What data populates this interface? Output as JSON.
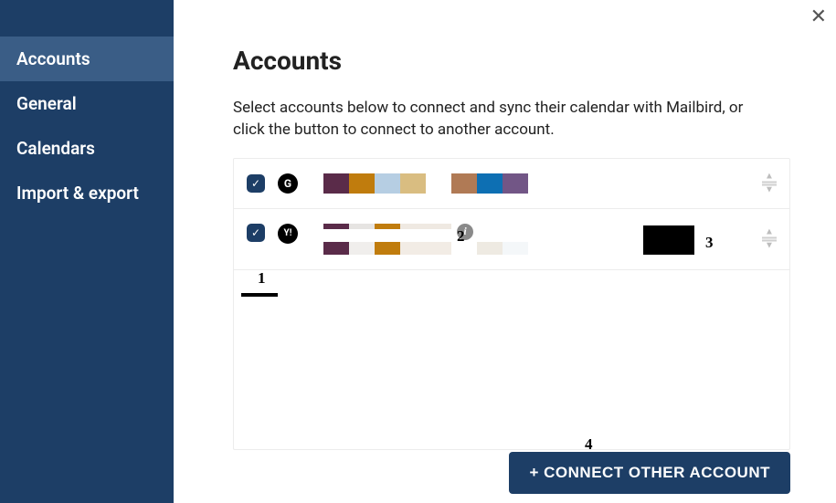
{
  "sidebar": {
    "items": [
      {
        "label": "Accounts",
        "active": true
      },
      {
        "label": "General",
        "active": false
      },
      {
        "label": "Calendars",
        "active": false
      },
      {
        "label": "Import & export",
        "active": false
      }
    ]
  },
  "header": {
    "title": "Accounts",
    "description": "Select accounts below to connect and sync their calendar with Mailbird, or click the button to connect to another account."
  },
  "accounts": [
    {
      "provider": "G",
      "checked": true,
      "swatches": [
        "#5a2b49",
        "#c07c0d",
        "#b6cee3",
        "#d9bd81",
        "transparent",
        "#b07a55",
        "#0d6fb3",
        "#725686"
      ]
    },
    {
      "provider": "Y!",
      "checked": true,
      "stripe_swatches": [
        "#5a2b49",
        "#e6e4e2",
        "#c07c0d",
        "#efe9e2",
        "#efe9e2"
      ],
      "block_swatches": [
        "#5a2b49",
        "#f0eeec",
        "#c07c0d",
        "#f2ece5",
        "#f2ece5",
        "transparent",
        "#eeeae2",
        "#f4f7f9"
      ],
      "info": "i"
    }
  ],
  "markers": {
    "one": "1",
    "two": "2",
    "three": "3",
    "four": "4"
  },
  "buttons": {
    "connect_other": "+ CONNECT OTHER ACCOUNT"
  }
}
